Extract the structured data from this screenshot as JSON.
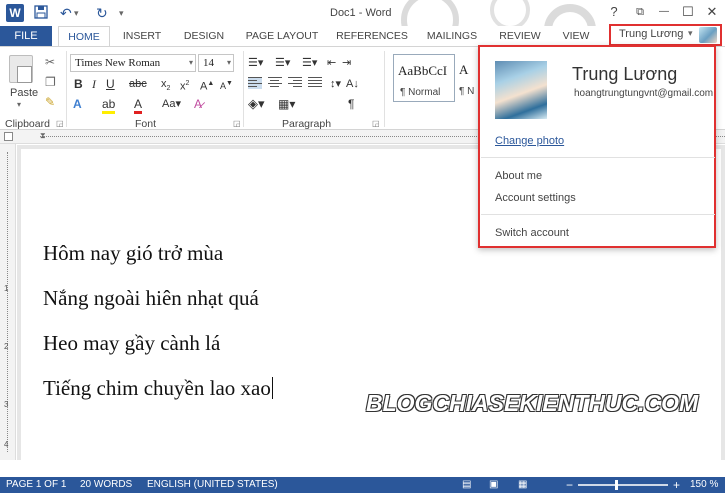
{
  "window": {
    "title": "Doc1 - Word",
    "controls": {
      "help": "?",
      "ribbon_display": "⧉",
      "minimize": "—",
      "maximize": "☐",
      "close": "✕"
    }
  },
  "quick_access": {
    "save_icon": "save-icon",
    "undo_icon": "undo-icon",
    "redo_icon": "redo-icon"
  },
  "tabs": {
    "file": "FILE",
    "items": [
      "HOME",
      "INSERT",
      "DESIGN",
      "PAGE LAYOUT",
      "REFERENCES",
      "MAILINGS",
      "REVIEW",
      "VIEW"
    ],
    "active": "HOME"
  },
  "account": {
    "name": "Trung Lương",
    "caret": "▾",
    "panel": {
      "display_name": "Trung Lương",
      "email": "hoangtrungtungvnt@gmail.com",
      "change_photo": "Change photo",
      "about_me": "About me",
      "account_settings": "Account settings",
      "switch_account": "Switch account"
    }
  },
  "ribbon": {
    "clipboard": {
      "label": "Clipboard",
      "paste": "Paste"
    },
    "font": {
      "label": "Font",
      "family": "Times New Roman",
      "size": "14"
    },
    "paragraph": {
      "label": "Paragraph"
    },
    "styles": {
      "sample": "AaBbCcI",
      "normal": "¶ Normal",
      "second_sample": "A",
      "second_name": "¶ N"
    }
  },
  "ruler": {
    "v_numbers": [
      "1",
      "2",
      "3",
      "4"
    ]
  },
  "document": {
    "lines": [
      "Hôm nay gió trở mùa",
      "Nắng ngoài hiên nhạt quá",
      "Heo may gầy cành lá",
      "Tiếng chim chuyền lao xao"
    ],
    "watermark": "BLOGCHIASEKIENTHUC.COM"
  },
  "status": {
    "page": "PAGE 1 OF 1",
    "words": "20 WORDS",
    "language": "ENGLISH (UNITED STATES)",
    "zoom_minus": "−",
    "zoom_plus": "+",
    "zoom": "150 %",
    "zoom_level_percent": 150
  },
  "colors": {
    "accent": "#2b579a",
    "highlight_border": "#e03030",
    "status_bar": "#2b579a"
  }
}
